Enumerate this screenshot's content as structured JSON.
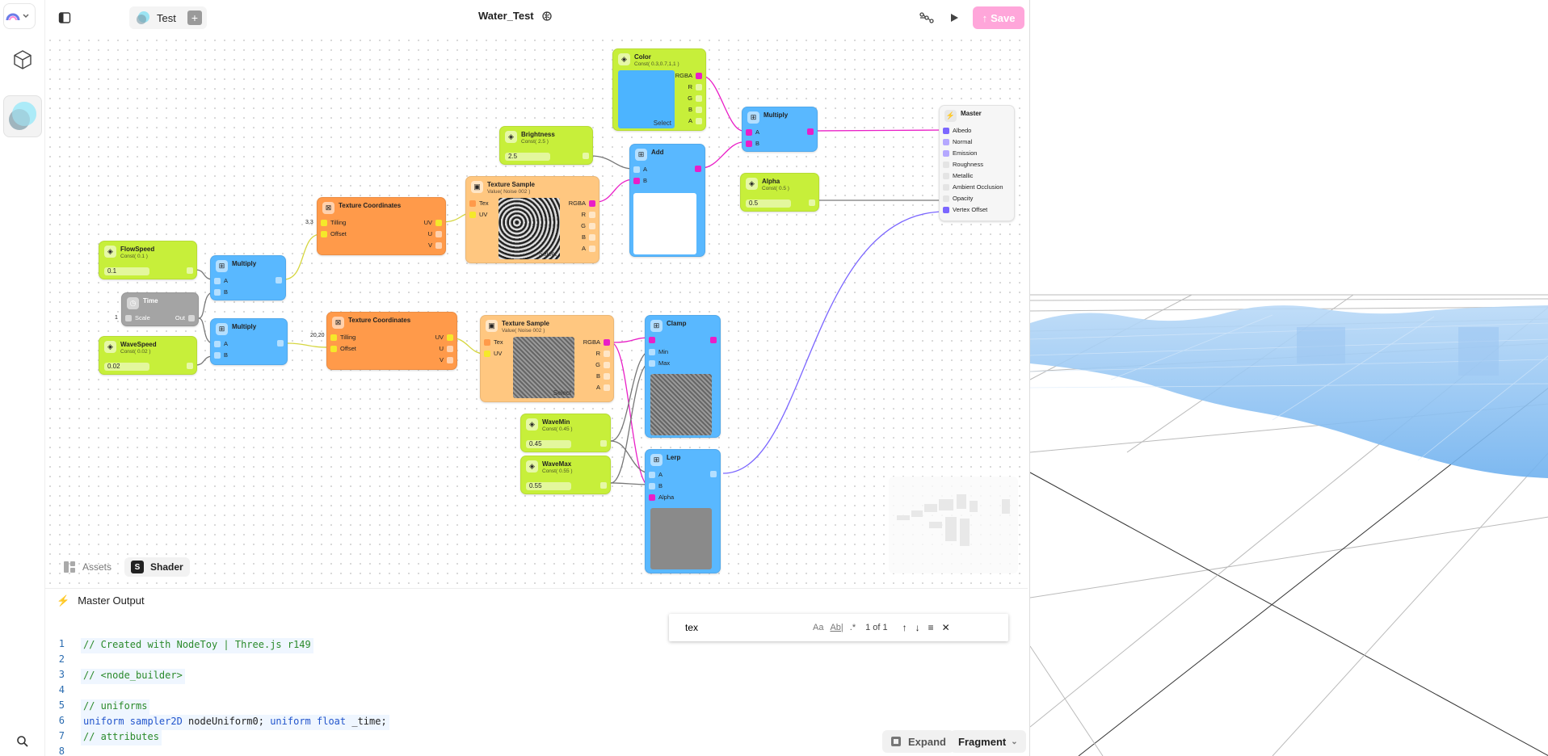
{
  "topbar": {
    "project_name": "Test",
    "doc_title": "Water_Test",
    "save_label": "Save"
  },
  "nodes": {
    "color": {
      "title": "Color",
      "sub": "Const( 0.3,0.7,1,1 )",
      "out": "RGBA",
      "ch": [
        "R",
        "G",
        "B",
        "A"
      ],
      "select": "Select"
    },
    "multiply_top": {
      "title": "Multiply",
      "a": "A",
      "b": "B"
    },
    "brightness": {
      "title": "Brightness",
      "sub": "Const( 2.5 )",
      "value": "2.5"
    },
    "add": {
      "title": "Add",
      "a": "A",
      "b": "B"
    },
    "alpha": {
      "title": "Alpha",
      "sub": "Const( 0.5 )",
      "value": "0.5"
    },
    "master": {
      "title": "Master",
      "inputs": [
        "Albedo",
        "Normal",
        "Emission",
        "Roughness",
        "Metallic",
        "Ambient Occlusion",
        "Opacity",
        "Vertex Offset"
      ]
    },
    "tex_sample_1": {
      "title": "Texture Sample",
      "sub": "Value( Noise 002 )",
      "tex": "Tex",
      "uv": "UV",
      "out": "RGBA",
      "ch": [
        "R",
        "G",
        "B",
        "A"
      ],
      "select": "Select"
    },
    "tex_coord_1": {
      "title": "Texture Coordinates",
      "tiling": "Tilling",
      "offset": "Offset",
      "uv": "UV",
      "u": "U",
      "v": "V",
      "tiling_value": "3,3"
    },
    "flowspeed": {
      "title": "FlowSpeed",
      "sub": "Const( 0.1 )",
      "value": "0.1"
    },
    "multiply_1": {
      "title": "Multiply",
      "a": "A",
      "b": "B"
    },
    "time": {
      "title": "Time",
      "scale": "Scale",
      "out": "Out",
      "scale_value": "1"
    },
    "multiply_2": {
      "title": "Multiply",
      "a": "A",
      "b": "B"
    },
    "wavespeed": {
      "title": "WaveSpeed",
      "sub": "Const( 0.02 )",
      "value": "0.02"
    },
    "tex_coord_2": {
      "title": "Texture Coordinates",
      "tiling": "Tilling",
      "offset": "Offset",
      "uv": "UV",
      "u": "U",
      "v": "V",
      "tiling_value": "20,20"
    },
    "tex_sample_2": {
      "title": "Texture Sample",
      "sub": "Value( Noise 002 )",
      "tex": "Tex",
      "uv": "UV",
      "out": "RGBA",
      "ch": [
        "R",
        "G",
        "B",
        "A"
      ],
      "select": "Select"
    },
    "clamp": {
      "title": "Clamp",
      "min": "Min",
      "max": "Max"
    },
    "wavemin": {
      "title": "WaveMin",
      "sub": "Const( 0.45 )",
      "value": "0.45"
    },
    "wavemax": {
      "title": "WaveMax",
      "sub": "Const( 0.55 )",
      "value": "0.55"
    },
    "lerp": {
      "title": "Lerp",
      "a": "A",
      "b": "B",
      "alpha": "Alpha"
    }
  },
  "bottom_tabs": [
    "Assets",
    "Shader"
  ],
  "code_panel": {
    "title": "Master Output",
    "lines": [
      {
        "n": "1",
        "text": "// Created with NodeToy | Three.js r149"
      },
      {
        "n": "2",
        "text": ""
      },
      {
        "n": "3",
        "text": "// <node_builder>"
      },
      {
        "n": "4",
        "text": ""
      },
      {
        "n": "5",
        "text": "// uniforms"
      },
      {
        "n": "6",
        "kw1": "uniform sampler2D",
        "t1": " nodeUniform0; ",
        "kw2": "uniform float",
        "t2": " _time;"
      },
      {
        "n": "7",
        "text": "// attributes"
      },
      {
        "n": "8",
        "text": ""
      }
    ],
    "find": {
      "value": "tex",
      "count": "1 of 1",
      "opt_case": "Aa",
      "opt_word": "Ab|",
      "opt_regex": ".*"
    },
    "expand_label": "Expand",
    "fragment_label": "Fragment"
  },
  "colors": {
    "save": "#ffa6da",
    "const_node": "#c7ef3a",
    "op_node": "#59b8ff",
    "coord_node": "#ff9a4a",
    "sample_node": "#ffc780",
    "color_wire": "#e91ec7",
    "vector_wire": "#d6d640",
    "float_wire": "#777777",
    "vertex_wire": "#7b66ff"
  }
}
